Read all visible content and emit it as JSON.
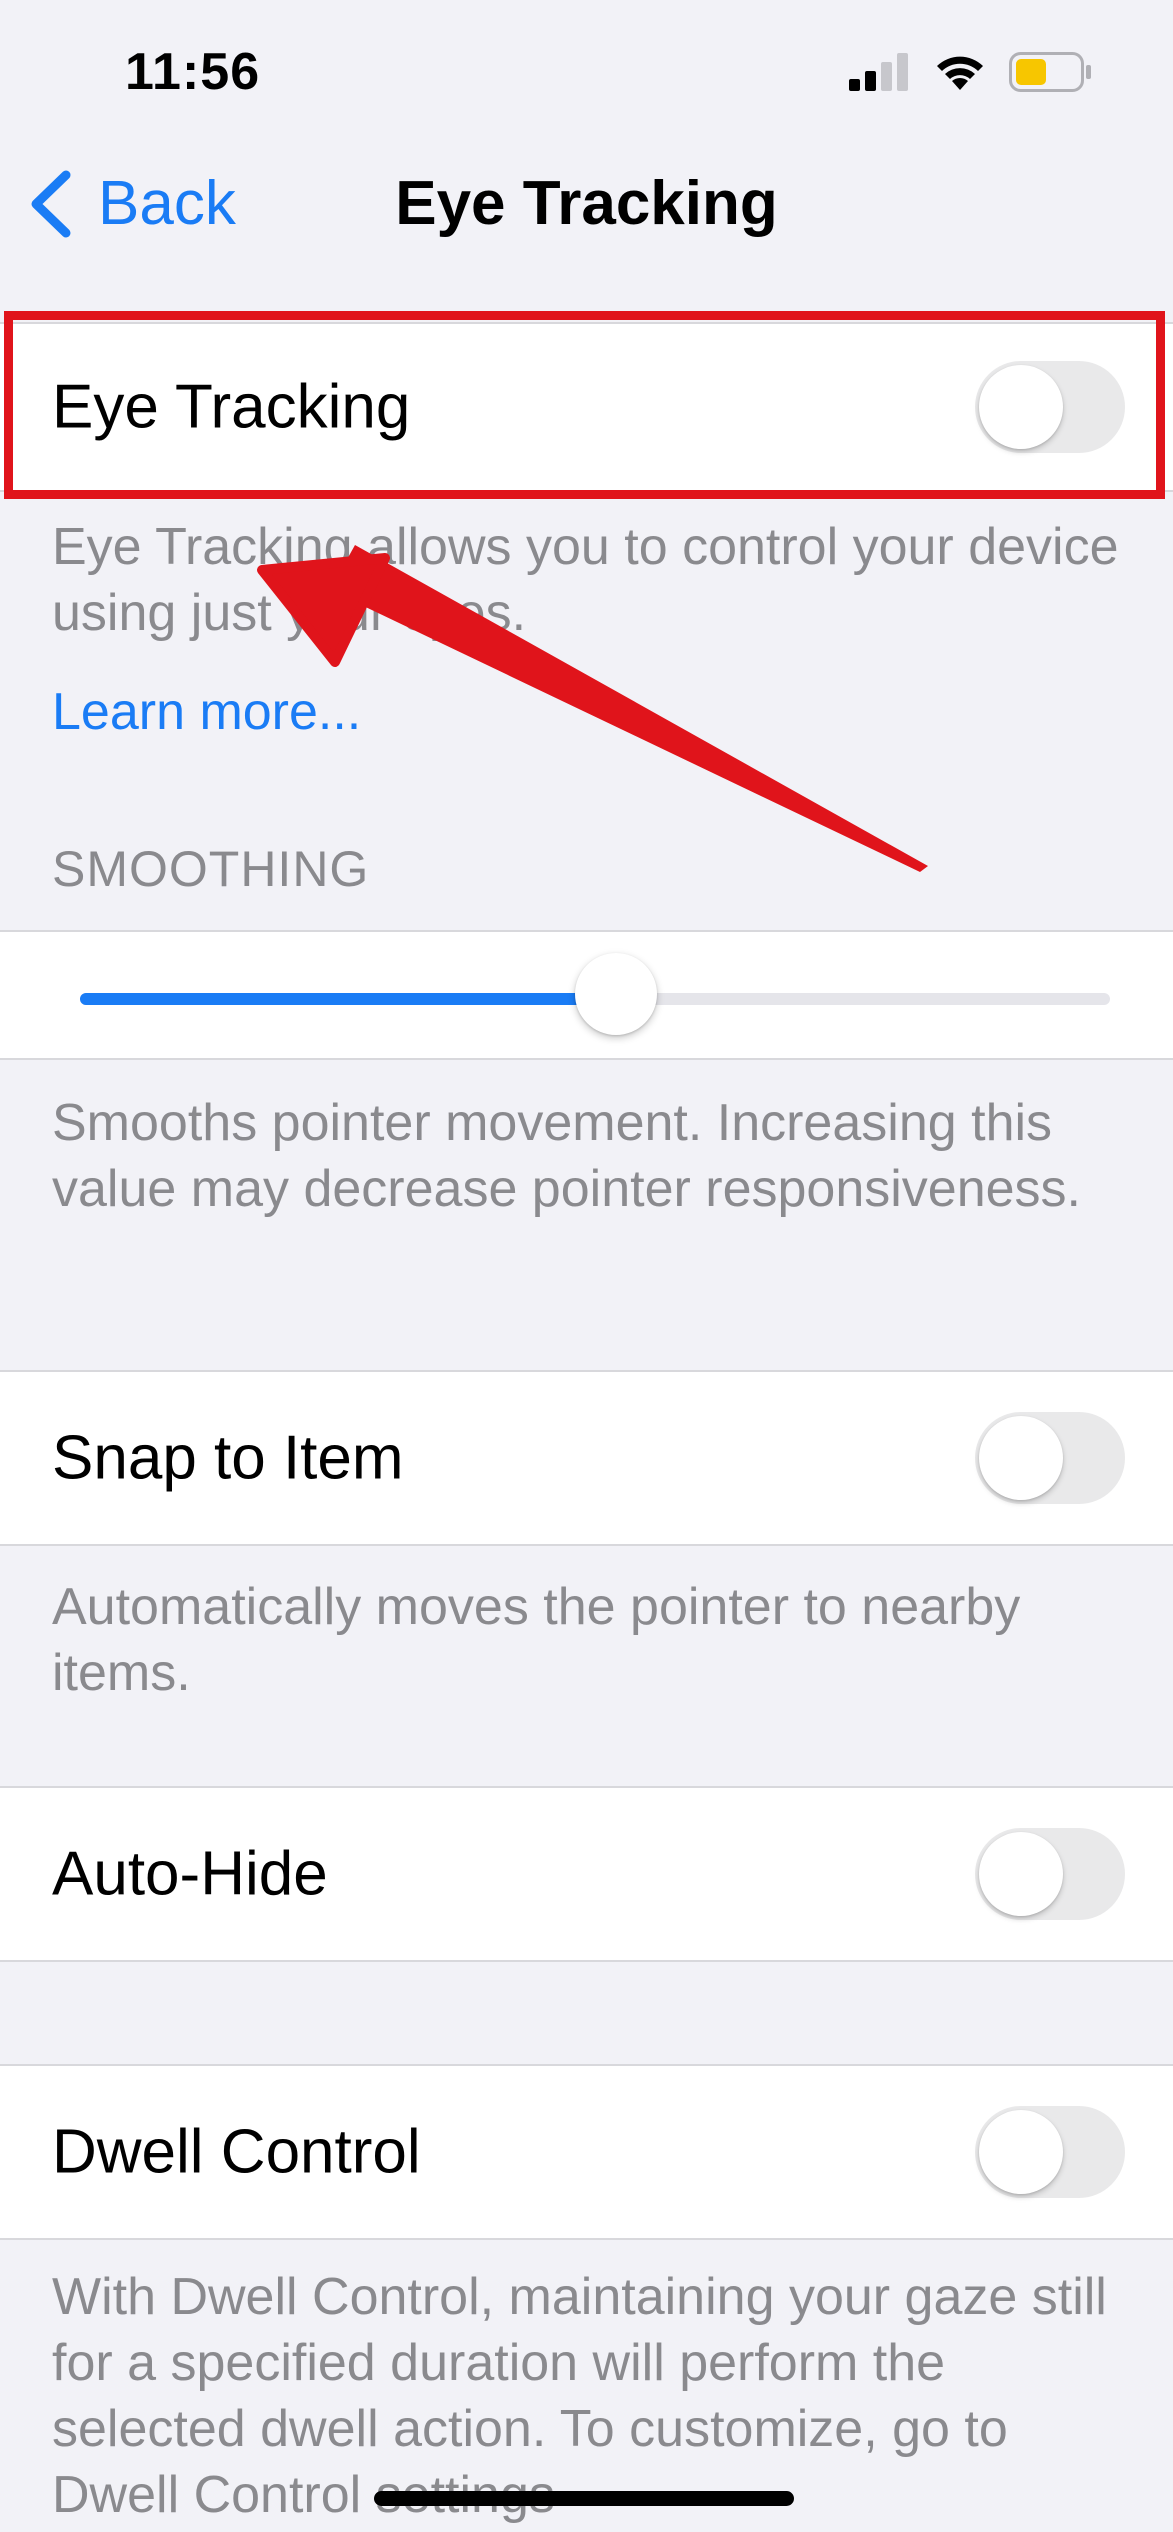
{
  "status_bar": {
    "time": "11:56",
    "icons": [
      "cellular-signal-icon",
      "wifi-icon",
      "battery-icon"
    ],
    "battery_color": "#f7c600"
  },
  "nav": {
    "back_label": "Back",
    "title": "Eye Tracking"
  },
  "eye_tracking": {
    "label": "Eye Tracking",
    "enabled": false,
    "description": "Eye Tracking allows you to control your device using just your eyes.",
    "learn_more": "Learn more..."
  },
  "smoothing": {
    "header": "SMOOTHING",
    "value_fraction": 0.52,
    "description": "Smooths pointer movement. Increasing this value may decrease pointer responsiveness."
  },
  "snap_to_item": {
    "label": "Snap to Item",
    "enabled": false,
    "description": "Automatically moves the pointer to nearby items."
  },
  "auto_hide": {
    "label": "Auto-Hide",
    "enabled": false
  },
  "dwell_control": {
    "label": "Dwell Control",
    "enabled": false,
    "description": "With Dwell Control, maintaining your gaze still for a specified duration will perform the selected dwell action. To customize, go to Dwell Control settings"
  },
  "colors": {
    "accent": "#1a7cf5",
    "annotation": "#e0141b",
    "background": "#f2f2f7",
    "toggle_off": "#e9e9ea"
  }
}
